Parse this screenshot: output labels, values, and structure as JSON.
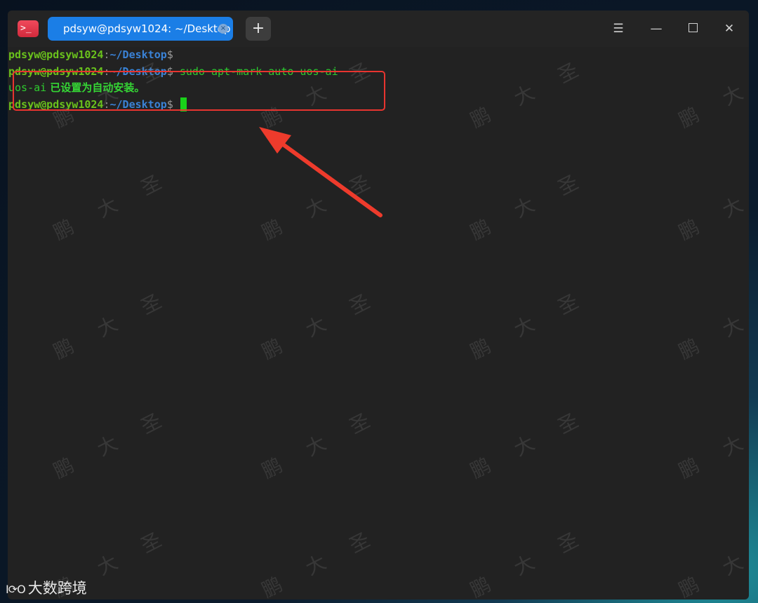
{
  "window": {
    "tab_title": "pdsyw@pdsyw1024: ~/Desktop",
    "tab_close_glyph": "×",
    "new_tab_glyph": "+",
    "icons": [
      "terminal-app-icon",
      "menu-icon",
      "minimize-icon",
      "maximize-icon",
      "close-icon"
    ]
  },
  "terminal": {
    "user_host": "pdsyw@pdsyw1024",
    "colon": ":",
    "path": "~/Desktop",
    "dollar": "$",
    "command": " sudo apt-mark auto uos-ai",
    "output_pkg": "uos-ai",
    "output_msg": " 已设置为自动安装。",
    "colors": {
      "user": "#6ac21c",
      "path": "#3a82d6",
      "command": "#2fcc2f",
      "cursor": "#19d119"
    }
  },
  "annotations": {
    "highlight_color": "#e8342f"
  },
  "watermark": {
    "text": "鹏大圣"
  },
  "brand": {
    "mark": "I⟳O",
    "name": "大数跨境"
  }
}
